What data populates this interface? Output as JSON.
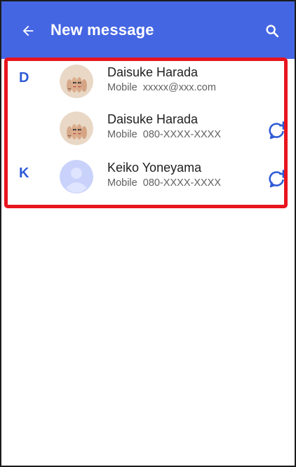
{
  "appbar": {
    "title": "New message",
    "back_icon": "arrow-back-icon",
    "search_icon": "search-icon",
    "color": "#4566e2"
  },
  "contacts": [
    {
      "section": "D",
      "name": "Daisuke Harada",
      "type": "Mobile",
      "value": "xxxxx@xxx.com",
      "avatar": "photo-avatar",
      "has_add_chat": false
    },
    {
      "section": "",
      "name": "Daisuke Harada",
      "type": "Mobile",
      "value": "080-XXXX-XXXX",
      "avatar": "photo-avatar",
      "has_add_chat": true
    },
    {
      "section": "K",
      "name": "Keiko Yoneyama",
      "type": "Mobile",
      "value": "080-XXXX-XXXX",
      "avatar": "placeholder-avatar",
      "has_add_chat": true
    }
  ],
  "colors": {
    "accent": "#2f5bd7",
    "highlight": "#e8141e"
  }
}
